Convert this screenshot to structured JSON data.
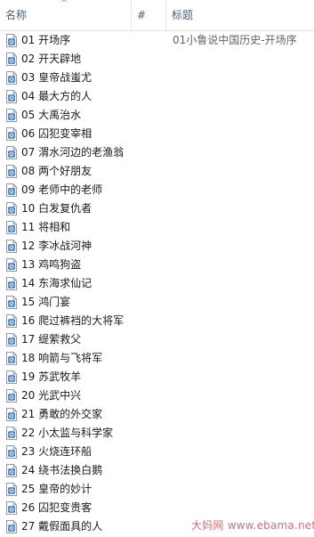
{
  "header": {
    "name_label": "名称",
    "num_label": "#",
    "title_label": "标题",
    "sort_indicator": "^"
  },
  "files": [
    {
      "name": "01 开场序",
      "title": "01小鲁说中国历史-开场序"
    },
    {
      "name": "02 开天辟地",
      "title": ""
    },
    {
      "name": "03 皇帝战蚩尤",
      "title": ""
    },
    {
      "name": "04 最大方的人",
      "title": ""
    },
    {
      "name": "05 大禹治水",
      "title": ""
    },
    {
      "name": "06 囚犯变宰相",
      "title": ""
    },
    {
      "name": "07 渭水河边的老渔翁",
      "title": ""
    },
    {
      "name": "08 两个好朋友",
      "title": ""
    },
    {
      "name": "09 老师中的老师",
      "title": ""
    },
    {
      "name": "10 白发复仇者",
      "title": ""
    },
    {
      "name": "11 将相和",
      "title": ""
    },
    {
      "name": "12 李冰战河神",
      "title": ""
    },
    {
      "name": "13 鸡鸣狗盗",
      "title": ""
    },
    {
      "name": "14 东海求仙记",
      "title": ""
    },
    {
      "name": "15 鸿门宴",
      "title": ""
    },
    {
      "name": "16 爬过裤裆的大将军",
      "title": ""
    },
    {
      "name": "17 缇萦救父",
      "title": ""
    },
    {
      "name": "18 响箭与飞将军",
      "title": ""
    },
    {
      "name": "19 苏武牧羊",
      "title": ""
    },
    {
      "name": "20 光武中兴",
      "title": ""
    },
    {
      "name": "21 勇敢的外交家",
      "title": ""
    },
    {
      "name": "22 小太监与科学家",
      "title": ""
    },
    {
      "name": "23 火烧连环船",
      "title": ""
    },
    {
      "name": "24 绕书法换白鹅",
      "title": ""
    },
    {
      "name": "25 皇帝的妙计",
      "title": ""
    },
    {
      "name": "26 囚犯变贵客",
      "title": ""
    },
    {
      "name": "27 戴假面具的人",
      "title": ""
    }
  ],
  "watermark": "大妈网 www.ebama.net",
  "colors": {
    "header_text": "#4c607a",
    "icon_blue": "#2f6fc4",
    "watermark": "#dc6a78"
  },
  "icon_name": "audio-file-icon"
}
